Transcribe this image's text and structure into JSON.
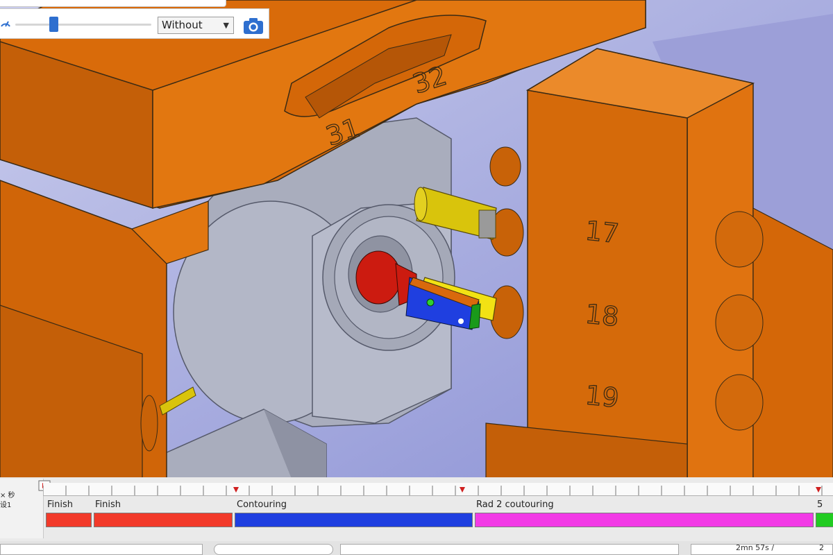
{
  "toolbar": {
    "speed_icon": "speed-icon",
    "slider_value": 0.28,
    "mode_select_value": "Without",
    "camera_icon": "camera-icon"
  },
  "viewport": {
    "labels": {
      "n31": "31",
      "n32": "32",
      "n17": "17",
      "n18": "18",
      "n19": "19"
    }
  },
  "timeline": {
    "left_panel": {
      "line1": "× 秒",
      "line2": "设1"
    },
    "operations": [
      {
        "label": "Finish",
        "color": "#f23a2a"
      },
      {
        "label": "Finish",
        "color": "#f23a2a"
      },
      {
        "label": "Contouring",
        "color": "#1f3fe0"
      },
      {
        "label": "Rad 2 coutouring",
        "color": "#f23ae6"
      },
      {
        "label": "5",
        "color": "#22cc22"
      }
    ],
    "time_readout": "2mn 57s /",
    "time_readout_2": "2"
  },
  "colors": {
    "part_orange": "#d96b0a",
    "housing_gray": "#a9adbd",
    "background": "#b8bde6",
    "accent_blue": "#2e6fcf"
  }
}
